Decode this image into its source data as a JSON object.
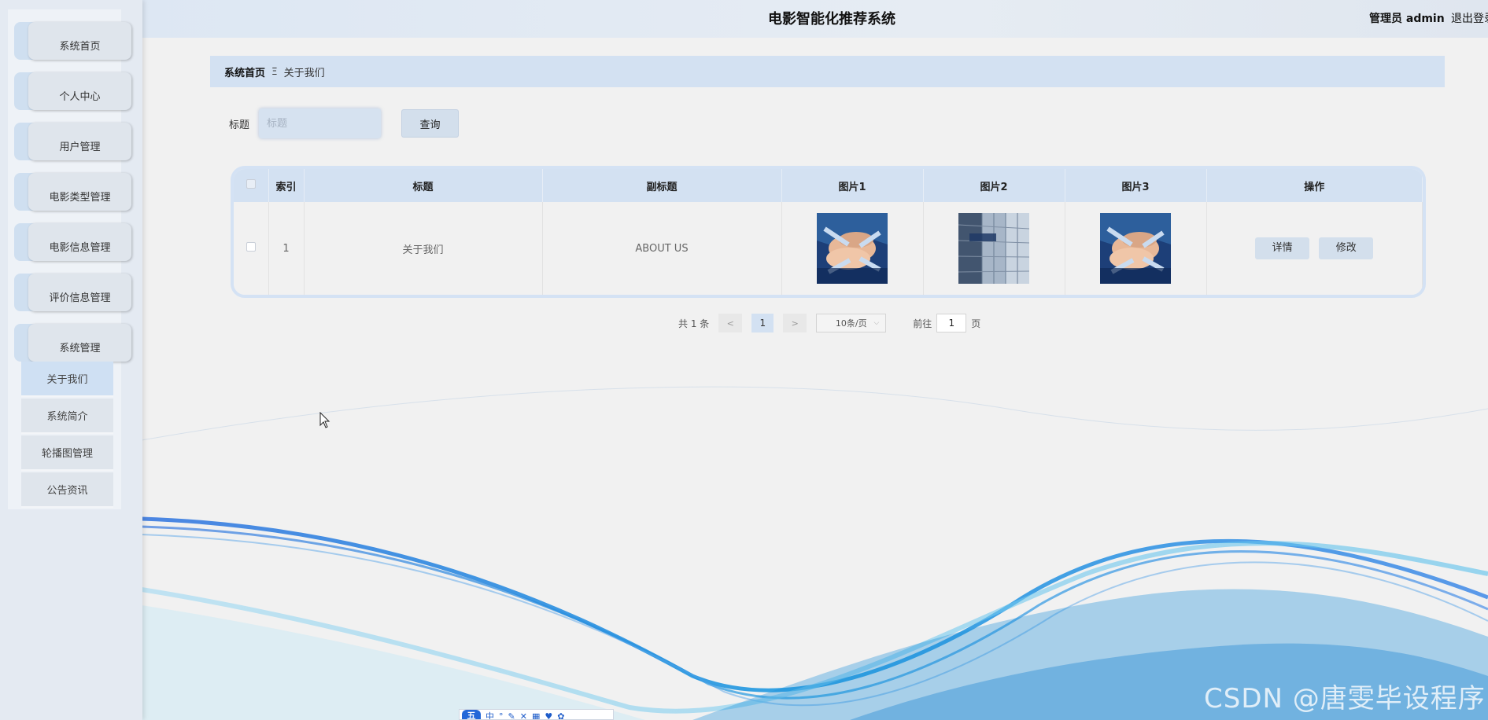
{
  "header": {
    "title": "电影智能化推荐系统",
    "user": "管理员 admin",
    "logout": "退出登录"
  },
  "sidebar": {
    "items": [
      {
        "label": "系统首页"
      },
      {
        "label": "个人中心"
      },
      {
        "label": "用户管理"
      },
      {
        "label": "电影类型管理"
      },
      {
        "label": "电影信息管理"
      },
      {
        "label": "评价信息管理"
      },
      {
        "label": "系统管理"
      }
    ],
    "sub_items": [
      {
        "label": "关于我们",
        "active": true
      },
      {
        "label": "系统简介"
      },
      {
        "label": "轮播图管理"
      },
      {
        "label": "公告资讯"
      }
    ]
  },
  "breadcrumb": {
    "home": "系统首页",
    "separator": "Ξ",
    "current": "关于我们"
  },
  "search": {
    "label": "标题",
    "placeholder": "标题",
    "button": "查询"
  },
  "table": {
    "columns": [
      "索引",
      "标题",
      "副标题",
      "图片1",
      "图片2",
      "图片3",
      "操作"
    ],
    "rows": [
      {
        "index": "1",
        "title": "关于我们",
        "subtitle": "ABOUT US",
        "img1": "hands-stack-image",
        "img2": "building-glass-image",
        "img3": "hands-stack-image",
        "actions": [
          "详情",
          "修改"
        ]
      }
    ]
  },
  "pagination": {
    "total": "共 1 条",
    "prev": "<",
    "page": "1",
    "next": ">",
    "page_size": "10条/页",
    "goto_label": "前往",
    "goto_value": "1",
    "goto_suffix": "页"
  },
  "watermark": "CSDN @唐雯毕设程序",
  "ime": {
    "logo": "五",
    "icons": [
      "中",
      "°",
      "✎",
      "✕",
      "▦",
      "♥",
      "✿"
    ]
  },
  "colors": {
    "accent": "#d3e1f2",
    "sidebar": "#e4eaf2",
    "wave": "#2a7de1"
  }
}
